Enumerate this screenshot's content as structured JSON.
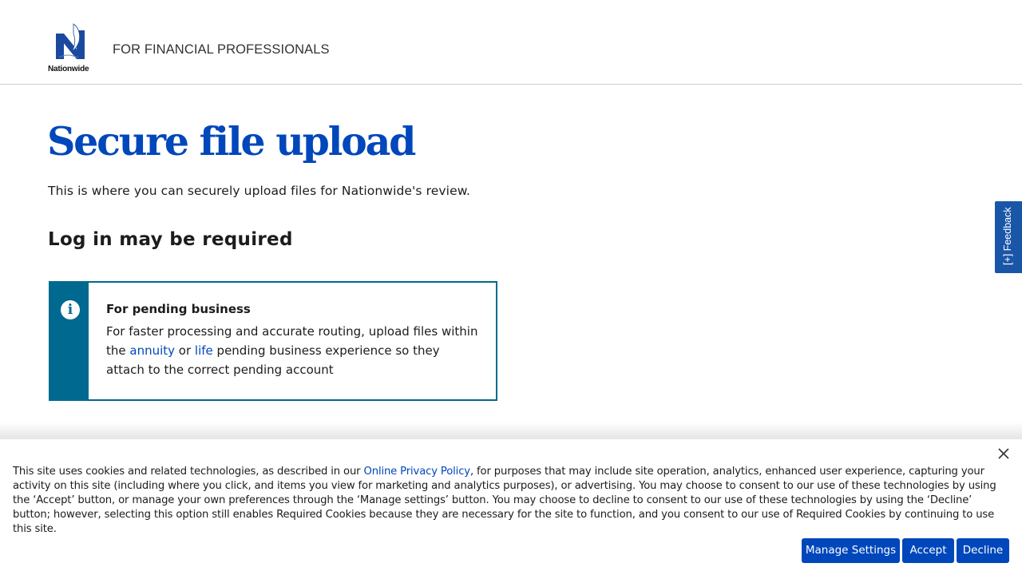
{
  "header": {
    "logo_text": "Nationwide",
    "title": "FOR FINANCIAL PROFESSIONALS"
  },
  "main": {
    "title": "Secure file upload",
    "intro": "This is where you can securely upload files for Nationwide's review.",
    "subhead": "Log in may be required",
    "infobox": {
      "icon": "info-icon",
      "heading": "For pending business",
      "text_before": "For faster processing and accurate routing, upload files within the ",
      "link_annuity": "annuity",
      "text_or": " or ",
      "link_life": "life",
      "text_after": " pending business experience so they attach to the correct pending account"
    }
  },
  "feedback": {
    "label": "[+] Feedback"
  },
  "cookie": {
    "text_before": "This site uses cookies and related technologies, as described in our ",
    "privacy_link": "Online Privacy Policy",
    "text_after": ", for purposes that may include site operation, analytics, enhanced user experience, capturing your activity on this site (including where you click, and items you view for marketing and analytics purposes), or advertising. You may choose to consent to our use of these technologies by using the ‘Accept’ button, or manage your own preferences through the ‘Manage settings’ button. You may choose to decline to consent to our use of these technologies by using the ‘Decline’ button; however, selecting this option still enables Required Cookies because they are necessary for the site to function, and you consent to our use of Required Cookies by continuing to use this site.",
    "manage_label": "Manage Settings",
    "accept_label": "Accept",
    "decline_label": "Decline"
  },
  "colors": {
    "brand_blue": "#0047bb",
    "info_teal": "#00698f",
    "feedback_blue": "#1a56a8"
  }
}
